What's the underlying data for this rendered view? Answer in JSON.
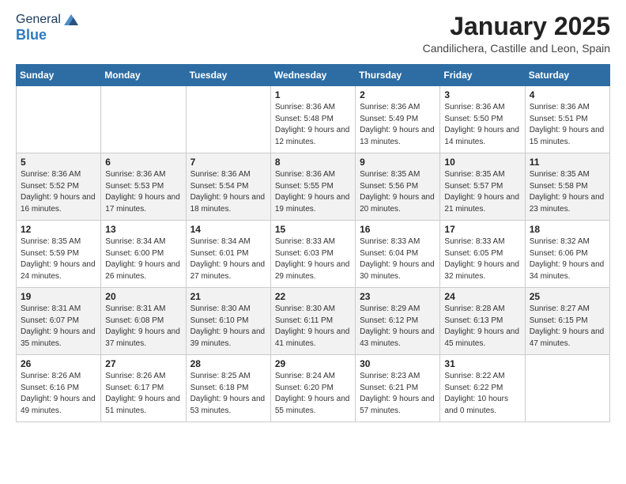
{
  "logo": {
    "general": "General",
    "blue": "Blue"
  },
  "title": "January 2025",
  "location": "Candilichera, Castille and Leon, Spain",
  "weekdays": [
    "Sunday",
    "Monday",
    "Tuesday",
    "Wednesday",
    "Thursday",
    "Friday",
    "Saturday"
  ],
  "weeks": [
    [
      {
        "day": "",
        "sunrise": "",
        "sunset": "",
        "daylight": ""
      },
      {
        "day": "",
        "sunrise": "",
        "sunset": "",
        "daylight": ""
      },
      {
        "day": "",
        "sunrise": "",
        "sunset": "",
        "daylight": ""
      },
      {
        "day": "1",
        "sunrise": "Sunrise: 8:36 AM",
        "sunset": "Sunset: 5:48 PM",
        "daylight": "Daylight: 9 hours and 12 minutes."
      },
      {
        "day": "2",
        "sunrise": "Sunrise: 8:36 AM",
        "sunset": "Sunset: 5:49 PM",
        "daylight": "Daylight: 9 hours and 13 minutes."
      },
      {
        "day": "3",
        "sunrise": "Sunrise: 8:36 AM",
        "sunset": "Sunset: 5:50 PM",
        "daylight": "Daylight: 9 hours and 14 minutes."
      },
      {
        "day": "4",
        "sunrise": "Sunrise: 8:36 AM",
        "sunset": "Sunset: 5:51 PM",
        "daylight": "Daylight: 9 hours and 15 minutes."
      }
    ],
    [
      {
        "day": "5",
        "sunrise": "Sunrise: 8:36 AM",
        "sunset": "Sunset: 5:52 PM",
        "daylight": "Daylight: 9 hours and 16 minutes."
      },
      {
        "day": "6",
        "sunrise": "Sunrise: 8:36 AM",
        "sunset": "Sunset: 5:53 PM",
        "daylight": "Daylight: 9 hours and 17 minutes."
      },
      {
        "day": "7",
        "sunrise": "Sunrise: 8:36 AM",
        "sunset": "Sunset: 5:54 PM",
        "daylight": "Daylight: 9 hours and 18 minutes."
      },
      {
        "day": "8",
        "sunrise": "Sunrise: 8:36 AM",
        "sunset": "Sunset: 5:55 PM",
        "daylight": "Daylight: 9 hours and 19 minutes."
      },
      {
        "day": "9",
        "sunrise": "Sunrise: 8:35 AM",
        "sunset": "Sunset: 5:56 PM",
        "daylight": "Daylight: 9 hours and 20 minutes."
      },
      {
        "day": "10",
        "sunrise": "Sunrise: 8:35 AM",
        "sunset": "Sunset: 5:57 PM",
        "daylight": "Daylight: 9 hours and 21 minutes."
      },
      {
        "day": "11",
        "sunrise": "Sunrise: 8:35 AM",
        "sunset": "Sunset: 5:58 PM",
        "daylight": "Daylight: 9 hours and 23 minutes."
      }
    ],
    [
      {
        "day": "12",
        "sunrise": "Sunrise: 8:35 AM",
        "sunset": "Sunset: 5:59 PM",
        "daylight": "Daylight: 9 hours and 24 minutes."
      },
      {
        "day": "13",
        "sunrise": "Sunrise: 8:34 AM",
        "sunset": "Sunset: 6:00 PM",
        "daylight": "Daylight: 9 hours and 26 minutes."
      },
      {
        "day": "14",
        "sunrise": "Sunrise: 8:34 AM",
        "sunset": "Sunset: 6:01 PM",
        "daylight": "Daylight: 9 hours and 27 minutes."
      },
      {
        "day": "15",
        "sunrise": "Sunrise: 8:33 AM",
        "sunset": "Sunset: 6:03 PM",
        "daylight": "Daylight: 9 hours and 29 minutes."
      },
      {
        "day": "16",
        "sunrise": "Sunrise: 8:33 AM",
        "sunset": "Sunset: 6:04 PM",
        "daylight": "Daylight: 9 hours and 30 minutes."
      },
      {
        "day": "17",
        "sunrise": "Sunrise: 8:33 AM",
        "sunset": "Sunset: 6:05 PM",
        "daylight": "Daylight: 9 hours and 32 minutes."
      },
      {
        "day": "18",
        "sunrise": "Sunrise: 8:32 AM",
        "sunset": "Sunset: 6:06 PM",
        "daylight": "Daylight: 9 hours and 34 minutes."
      }
    ],
    [
      {
        "day": "19",
        "sunrise": "Sunrise: 8:31 AM",
        "sunset": "Sunset: 6:07 PM",
        "daylight": "Daylight: 9 hours and 35 minutes."
      },
      {
        "day": "20",
        "sunrise": "Sunrise: 8:31 AM",
        "sunset": "Sunset: 6:08 PM",
        "daylight": "Daylight: 9 hours and 37 minutes."
      },
      {
        "day": "21",
        "sunrise": "Sunrise: 8:30 AM",
        "sunset": "Sunset: 6:10 PM",
        "daylight": "Daylight: 9 hours and 39 minutes."
      },
      {
        "day": "22",
        "sunrise": "Sunrise: 8:30 AM",
        "sunset": "Sunset: 6:11 PM",
        "daylight": "Daylight: 9 hours and 41 minutes."
      },
      {
        "day": "23",
        "sunrise": "Sunrise: 8:29 AM",
        "sunset": "Sunset: 6:12 PM",
        "daylight": "Daylight: 9 hours and 43 minutes."
      },
      {
        "day": "24",
        "sunrise": "Sunrise: 8:28 AM",
        "sunset": "Sunset: 6:13 PM",
        "daylight": "Daylight: 9 hours and 45 minutes."
      },
      {
        "day": "25",
        "sunrise": "Sunrise: 8:27 AM",
        "sunset": "Sunset: 6:15 PM",
        "daylight": "Daylight: 9 hours and 47 minutes."
      }
    ],
    [
      {
        "day": "26",
        "sunrise": "Sunrise: 8:26 AM",
        "sunset": "Sunset: 6:16 PM",
        "daylight": "Daylight: 9 hours and 49 minutes."
      },
      {
        "day": "27",
        "sunrise": "Sunrise: 8:26 AM",
        "sunset": "Sunset: 6:17 PM",
        "daylight": "Daylight: 9 hours and 51 minutes."
      },
      {
        "day": "28",
        "sunrise": "Sunrise: 8:25 AM",
        "sunset": "Sunset: 6:18 PM",
        "daylight": "Daylight: 9 hours and 53 minutes."
      },
      {
        "day": "29",
        "sunrise": "Sunrise: 8:24 AM",
        "sunset": "Sunset: 6:20 PM",
        "daylight": "Daylight: 9 hours and 55 minutes."
      },
      {
        "day": "30",
        "sunrise": "Sunrise: 8:23 AM",
        "sunset": "Sunset: 6:21 PM",
        "daylight": "Daylight: 9 hours and 57 minutes."
      },
      {
        "day": "31",
        "sunrise": "Sunrise: 8:22 AM",
        "sunset": "Sunset: 6:22 PM",
        "daylight": "Daylight: 10 hours and 0 minutes."
      },
      {
        "day": "",
        "sunrise": "",
        "sunset": "",
        "daylight": ""
      }
    ]
  ]
}
